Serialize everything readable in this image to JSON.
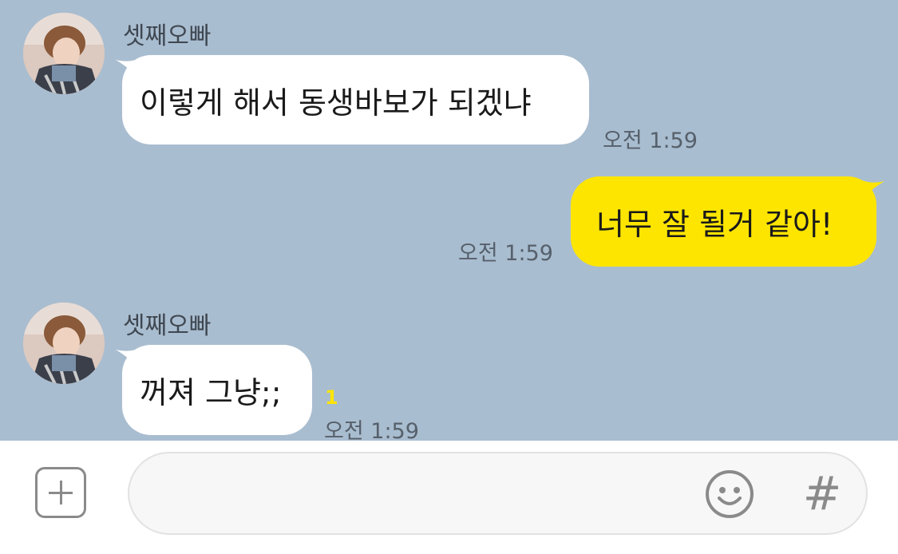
{
  "colors": {
    "chat_background": "#a9bdd0",
    "received_bubble": "#ffffff",
    "sent_bubble": "#fee500",
    "unread_count": "#fee500"
  },
  "messages": [
    {
      "direction": "received",
      "sender": "셋째오빠",
      "text": "이렇게 해서 동생바보가 되겠냐",
      "time": "오전 1:59"
    },
    {
      "direction": "sent",
      "text": "너무 잘 될거 같아!",
      "time": "오전 1:59"
    },
    {
      "direction": "received",
      "sender": "셋째오빠",
      "text": "꺼져 그냥;;",
      "time": "오전 1:59",
      "unread": "1"
    }
  ],
  "input_bar": {
    "add_icon": "plus-square-icon",
    "message_value": "",
    "emoji_icon": "smiley-icon",
    "hashtag_icon": "#"
  }
}
